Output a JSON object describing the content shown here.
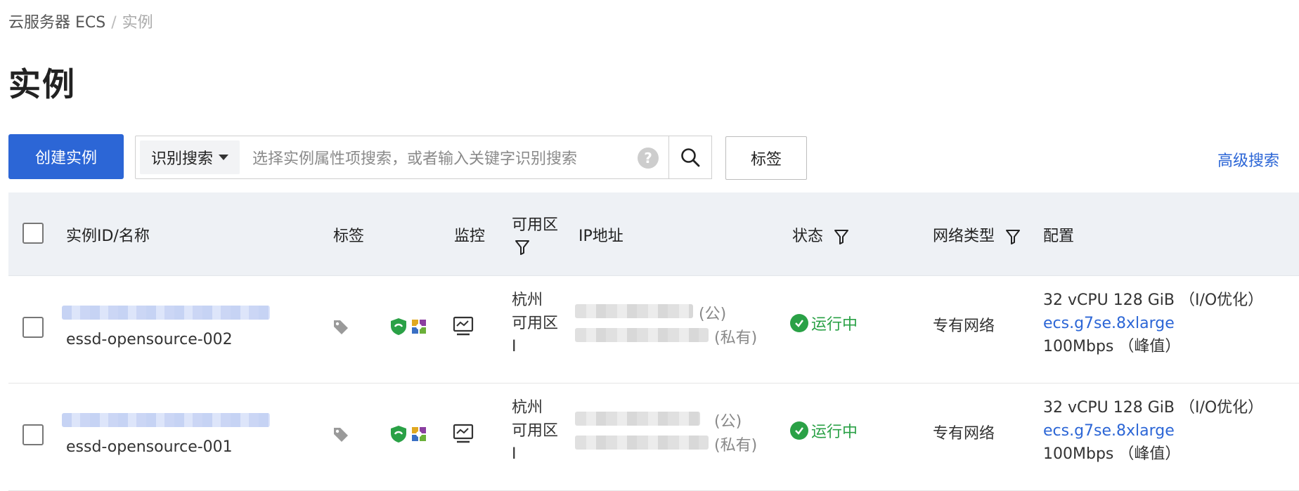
{
  "breadcrumb": {
    "root": "云服务器 ECS",
    "separator": "/",
    "current": "实例"
  },
  "page_title": "实例",
  "toolbar": {
    "create_button": "创建实例",
    "search_type": "识别搜索",
    "search_placeholder": "选择实例属性项搜索，或者输入关键字识别搜索",
    "help_glyph": "?",
    "tag_button": "标签",
    "advanced_search": "高级搜索"
  },
  "table": {
    "headers": {
      "instance": "实例ID/名称",
      "tags": "标签",
      "monitor": "监控",
      "zone": "可用区",
      "ip": "IP地址",
      "status": "状态",
      "network": "网络类型",
      "config": "配置"
    },
    "rows": [
      {
        "name": "essd-opensource-002",
        "zone_line1": "杭州",
        "zone_line2": "可用区",
        "zone_line3": "I",
        "ip_public_label": "(公)",
        "ip_private_label": "(私有)",
        "status": "运行中",
        "network": "专有网络",
        "config_spec": "32 vCPU 128 GiB （I/O优化）",
        "config_type": "ecs.g7se.8xlarge",
        "config_bandwidth": "100Mbps （峰值）"
      },
      {
        "name": "essd-opensource-001",
        "zone_line1": "杭州",
        "zone_line2": "可用区",
        "zone_line3": "I",
        "ip_public_label": "(公)",
        "ip_private_label": "(私有)",
        "status": "运行中",
        "network": "专有网络",
        "config_spec": "32 vCPU 128 GiB （I/O优化）",
        "config_type": "ecs.g7se.8xlarge",
        "config_bandwidth": "100Mbps （峰值）"
      }
    ]
  },
  "colors": {
    "primary": "#2c66d6",
    "running": "#2aa146",
    "header_bg": "#eef1f5",
    "shield": "#2aa146"
  },
  "icons": [
    "tag-icon",
    "shield-icon",
    "os-logo-icon",
    "monitor-icon",
    "filter-icon",
    "search-icon",
    "check-circle-icon",
    "help-icon",
    "caret-down-icon"
  ]
}
